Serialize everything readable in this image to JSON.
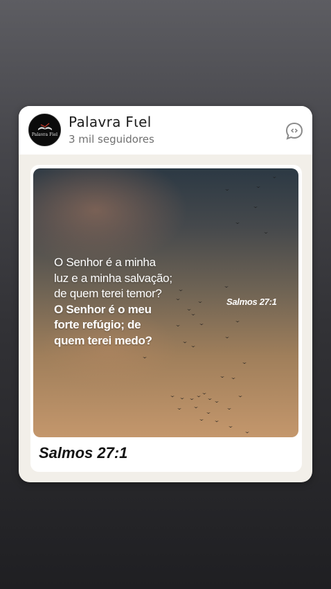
{
  "channel": {
    "name": "Palavra Fιel",
    "followers": "3 mil seguidores",
    "avatar_label": "Palavra Fiel"
  },
  "post": {
    "verse_lines": [
      "O Senhor é a minha",
      "luz e a minha salvação;",
      "de quem terei temor?",
      "O Senhor é o meu",
      "forte refúgio; de",
      "quem terei medo?"
    ],
    "image_reference": "Salmos 27:1",
    "caption": "Salmos 27:1"
  },
  "icons": {
    "avatar": "book-logo-icon",
    "header_action": "chat-bubble-icon",
    "image_decor": "flying-birds-icon"
  },
  "colors": {
    "card_bg": "#f2efe9",
    "header_bg": "#ffffff",
    "text_primary": "#1d1d1d",
    "text_secondary": "#707070",
    "icon_gray": "#8a8a8a"
  }
}
